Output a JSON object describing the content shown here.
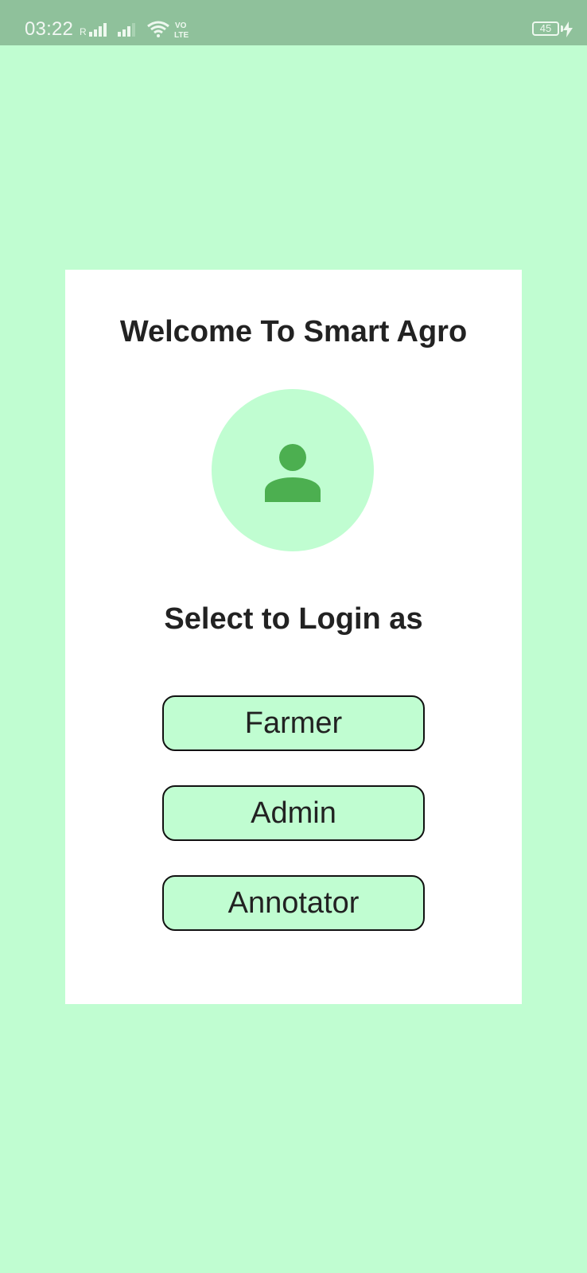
{
  "status_bar": {
    "time": "03:22",
    "battery_level": "45",
    "icons": [
      "roaming-signal-icon",
      "signal-icon",
      "wifi-icon",
      "volte-icon",
      "battery-icon",
      "charging-icon"
    ]
  },
  "login": {
    "title": "Welcome To Smart Agro",
    "avatar_icon": "user-icon",
    "subtitle": "Select to Login as",
    "roles": [
      {
        "label": "Farmer"
      },
      {
        "label": "Admin"
      },
      {
        "label": "Annotator"
      }
    ]
  },
  "colors": {
    "background": "#c0fdd1",
    "status_bar": "#8fc19b",
    "card": "#ffffff",
    "avatar_icon": "#4caf50",
    "text": "#222222",
    "button_border": "#111111"
  }
}
